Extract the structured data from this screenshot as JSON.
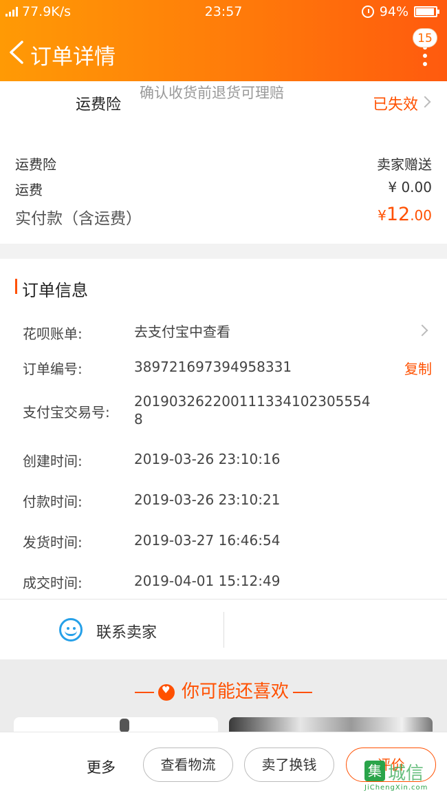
{
  "status_bar": {
    "network": "77.9K/s",
    "time": "23:57",
    "battery": "94%",
    "battery_level": 0.94
  },
  "header": {
    "title": "订单详情",
    "badge": "15"
  },
  "insurance": {
    "name": "运费险",
    "desc": "确认收货前退货可理赔",
    "status": "已失效",
    "summary_label": "运费险",
    "summary_value": "卖家赠送",
    "shipping_label": "运费",
    "shipping_value": "¥ 0.00",
    "paid_label": "实付款（含运费）",
    "paid_currency": "¥",
    "paid_int": "12",
    "paid_dec": ".00"
  },
  "order_info": {
    "title": "订单信息",
    "rows": [
      {
        "label": "花呗账单:",
        "value": "去支付宝中查看"
      },
      {
        "label": "订单编号:",
        "value": "389721697394958331",
        "action": "复制"
      },
      {
        "label": "支付宝交易号:",
        "value": "2019032622001113341023055548"
      },
      {
        "label": "创建时间:",
        "value": "2019-03-26 23:10:16"
      },
      {
        "label": "付款时间:",
        "value": "2019-03-26 23:10:21"
      },
      {
        "label": "发货时间:",
        "value": "2019-03-27 16:46:54"
      },
      {
        "label": "成交时间:",
        "value": "2019-04-01 15:12:49"
      }
    ]
  },
  "contact": {
    "label": "联系卖家"
  },
  "recommend": {
    "title": "你可能还喜欢"
  },
  "bottom_bar": {
    "more": "更多",
    "logistics": "查看物流",
    "sell": "卖了换钱",
    "review": "评价"
  },
  "watermark": {
    "main": "城信",
    "sub": "JiChengXin.com"
  },
  "colors": {
    "accent": "#ff5000",
    "header_start": "#ff9a05",
    "header_end": "#ff5a0e"
  }
}
